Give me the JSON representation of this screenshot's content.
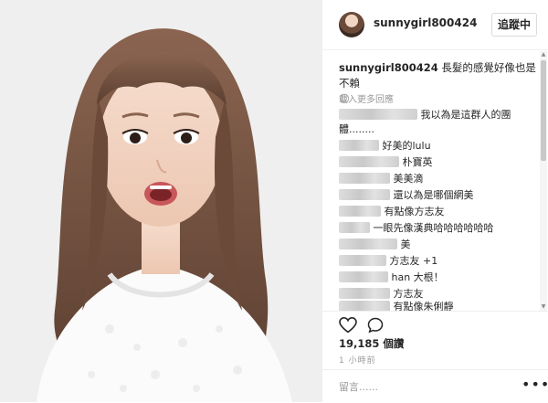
{
  "header": {
    "username": "sunnygirl800424",
    "follow_label": "追蹤中"
  },
  "caption": {
    "username": "sunnygirl800424",
    "text": "長髮的感覺好像也是不賴",
    "emoji": "☺"
  },
  "load_more_label": "載入更多回應",
  "comments": [
    {
      "text": "我以為是這群人的團",
      "text2": "體........"
    },
    {
      "text": "好美的lulu"
    },
    {
      "text": "朴寶英"
    },
    {
      "text": "美美滴"
    },
    {
      "text": "還以為是哪個網美"
    },
    {
      "text": "有點像方志友"
    },
    {
      "text": "一眼先像漢典哈哈哈哈哈哈"
    },
    {
      "text": "美"
    },
    {
      "text": "方志友 +1"
    },
    {
      "text": "han 大根！"
    },
    {
      "text": "方志友"
    },
    {
      "text": "有點像朱俐靜"
    }
  ],
  "likes": {
    "count": "19,185",
    "unit": "個讚"
  },
  "time_ago": "1 小時前",
  "comment_placeholder": "留言......",
  "icons": {
    "like": "heart-icon",
    "comment": "comment-bubble-icon",
    "more": "more-options-icon"
  },
  "colors": {
    "text": "#262626",
    "muted": "#999999",
    "border": "#efefef"
  }
}
